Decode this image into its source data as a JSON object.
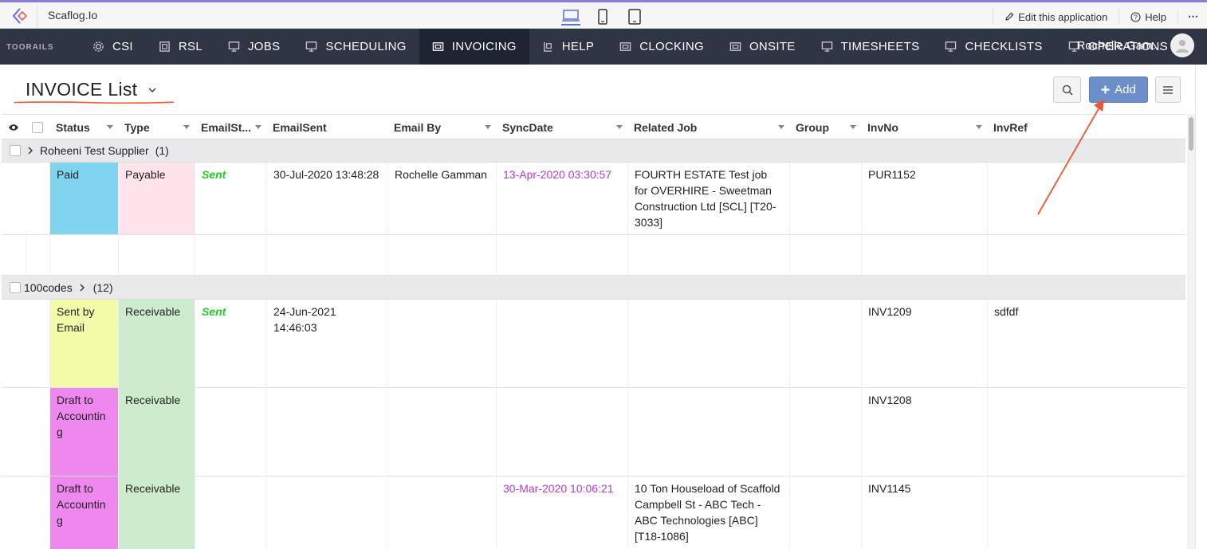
{
  "topbar": {
    "app_name": "Scaflog.Io",
    "edit_label": "Edit this application",
    "help_label": "Help",
    "more_label": "⋯"
  },
  "nav": {
    "brand": "TOORAILS",
    "items": [
      {
        "label": "CSI",
        "icon": "gear-icon"
      },
      {
        "label": "RSL",
        "icon": "document-icon"
      },
      {
        "label": "JOBS",
        "icon": "monitor-icon"
      },
      {
        "label": "SCHEDULING",
        "icon": "monitor-icon"
      },
      {
        "label": "INVOICING",
        "icon": "invoice-icon",
        "active": true
      },
      {
        "label": "HELP",
        "icon": "help-desk-icon"
      },
      {
        "label": "CLOCKING",
        "icon": "invoice-icon"
      },
      {
        "label": "ONSITE",
        "icon": "invoice-icon"
      },
      {
        "label": "TIMESHEETS",
        "icon": "monitor-icon"
      },
      {
        "label": "CHECKLISTS",
        "icon": "monitor-icon"
      },
      {
        "label": "OPERATIONS",
        "icon": "monitor-icon"
      }
    ],
    "user_name": "Rochelle Gam..."
  },
  "page": {
    "title": "INVOICE List",
    "add_label": "Add"
  },
  "columns": [
    "Status",
    "Type",
    "EmailSt...",
    "EmailSent",
    "Email By",
    "SyncDate",
    "Related Job",
    "Group",
    "InvNo",
    "InvRef"
  ],
  "groups": [
    {
      "label": "Roheeni Test Supplier",
      "count": "(1)"
    },
    {
      "label": "100codes",
      "count": "(12)"
    }
  ],
  "rows": [
    {
      "status": "Paid",
      "type": "Payable",
      "email_status": "Sent",
      "email_sent": "30-Jul-2020 13:48:28",
      "email_by": "Rochelle Gamman",
      "sync_date": "13-Apr-2020 03:30:57",
      "related_job": "FOURTH ESTATE Test job for OVERHIRE - Sweetman Construction Ltd [SCL] [T20-3033]",
      "group": "",
      "inv_no": "PUR1152",
      "inv_ref": ""
    },
    {
      "status": "",
      "type": "",
      "email_status": "",
      "email_sent": "",
      "email_by": "",
      "sync_date": "",
      "related_job": "",
      "group": "",
      "inv_no": "",
      "inv_ref": ""
    },
    {
      "status": "Sent by Email",
      "type": "Receivable",
      "email_status": "Sent",
      "email_sent": "24-Jun-2021 14:46:03",
      "email_by": "",
      "sync_date": "",
      "related_job": "",
      "group": "",
      "inv_no": "INV1209",
      "inv_ref": "sdfdf"
    },
    {
      "status": "Draft to Accountin g",
      "type": "Receivable",
      "email_status": "",
      "email_sent": "",
      "email_by": "",
      "sync_date": "",
      "related_job": "",
      "group": "",
      "inv_no": "INV1208",
      "inv_ref": ""
    },
    {
      "status": "Draft to Accountin g",
      "type": "Receivable",
      "email_status": "",
      "email_sent": "",
      "email_by": "",
      "sync_date": "30-Mar-2020 10:06:21",
      "related_job": "10 Ton Houseload of Scaffold Campbell St - ABC Tech - ABC Technologies [ABC] [T18-1086]",
      "group": "",
      "inv_no": "INV1145",
      "inv_ref": ""
    }
  ],
  "colors": {
    "status_paid": "#80d4f0",
    "status_sent_by_email": "#f1fba8",
    "status_draft": "#ef88ee",
    "type_payable": "#fde3ea",
    "type_receivable": "#cdeccd",
    "annotation": "#f0552f"
  }
}
